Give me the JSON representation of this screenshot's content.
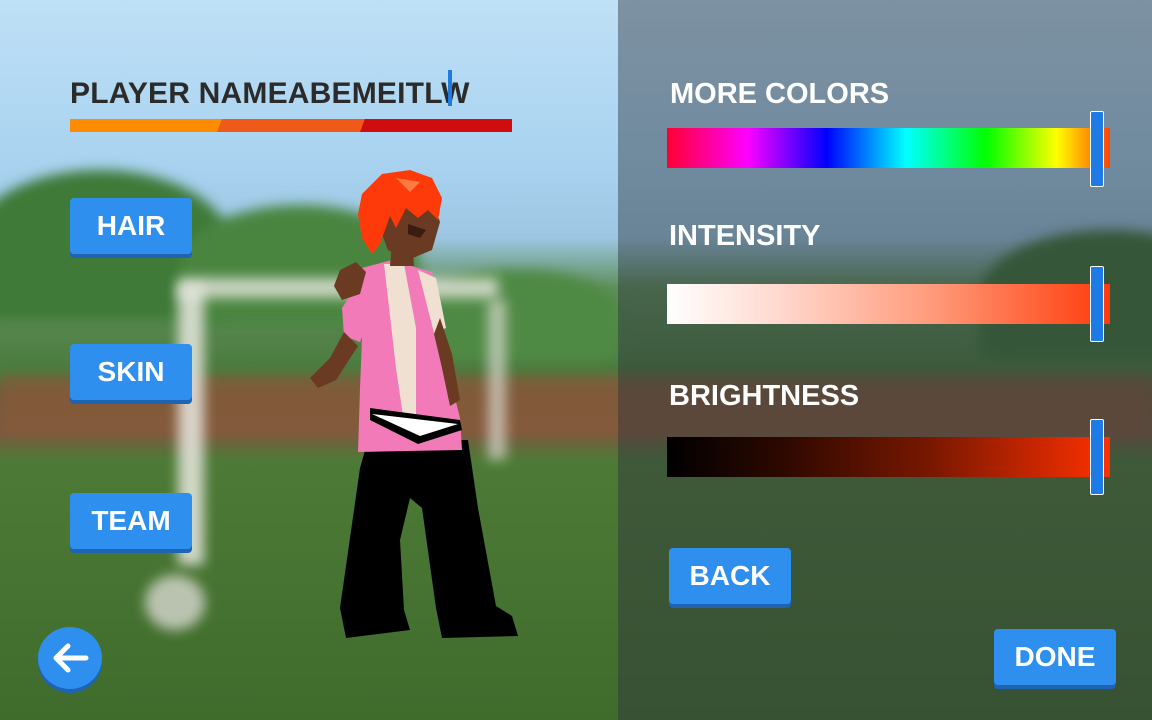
{
  "player": {
    "name": "PLAYER NAMEABEMEITLW"
  },
  "left_menu": {
    "hair_label": "HAIR",
    "skin_label": "SKIN",
    "team_label": "TEAM"
  },
  "color_panel": {
    "more_colors_label": "MORE COLORS",
    "intensity_label": "INTENSITY",
    "brightness_label": "BRIGHTNESS",
    "more_colors_level": 0.97,
    "intensity_level": 0.97,
    "brightness_level": 0.97
  },
  "buttons": {
    "back_label": "BACK",
    "done_label": "DONE"
  },
  "icons": {
    "round_back": "arrow-left-icon"
  },
  "colors": {
    "accent": "#2f8fee",
    "name_underline": [
      "#ff8c00",
      "#f05a18",
      "#d10c0c"
    ],
    "hair": "#ff3a0a",
    "shirt": "#f27ab8",
    "skin": "#6a3a22",
    "pants": "#000000"
  }
}
